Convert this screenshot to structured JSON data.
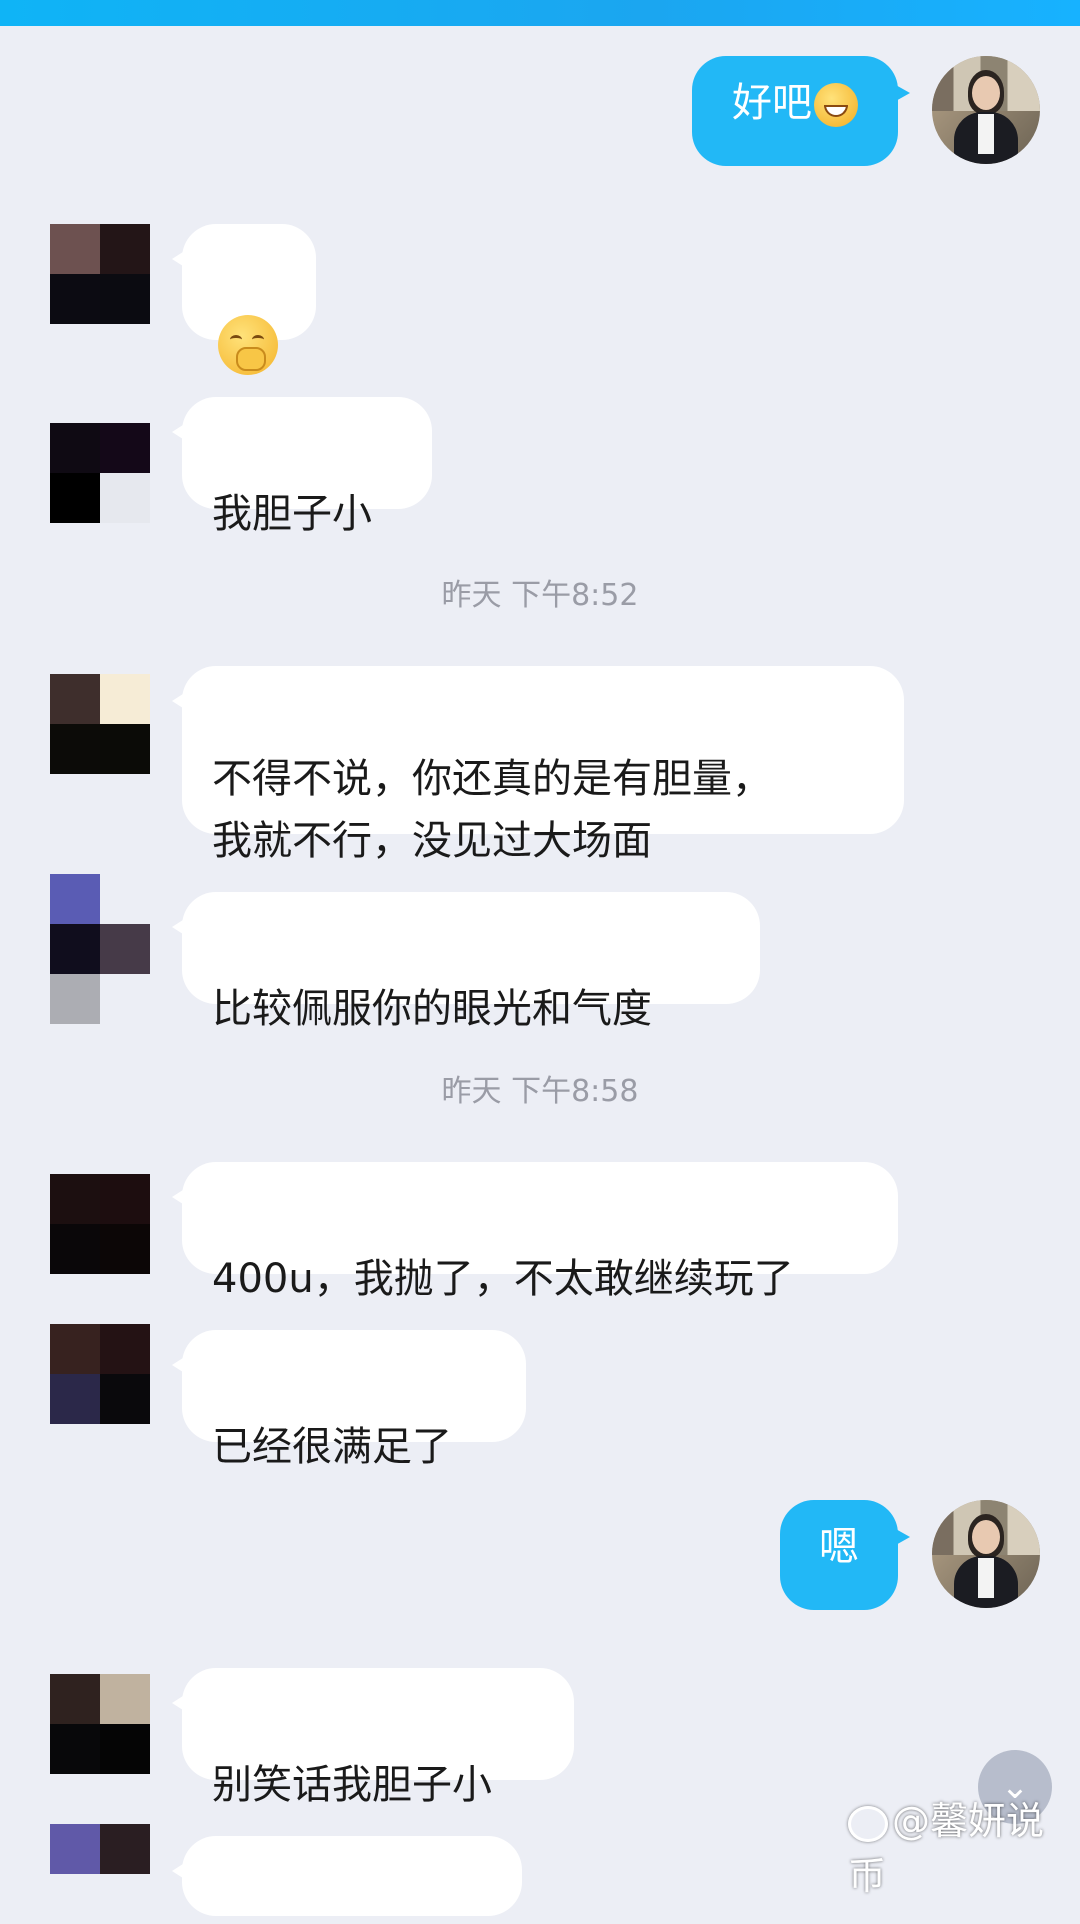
{
  "header": {
    "title": ""
  },
  "messages": [
    {
      "id": "m1",
      "direction": "out",
      "text": "好吧",
      "emoji": "laughing-tears-emoji"
    },
    {
      "id": "m2",
      "direction": "in",
      "text": "",
      "emoji": "smirk-hand-over-mouth-emoji"
    },
    {
      "id": "m3",
      "direction": "in",
      "text": "我胆子小"
    },
    {
      "id": "t1",
      "type": "timestamp",
      "text": "昨天 下午8:52"
    },
    {
      "id": "m4",
      "direction": "in",
      "text": "不得不说，你还真的是有胆量，\n我就不行，没见过大场面"
    },
    {
      "id": "m5",
      "direction": "in",
      "text": "比较佩服你的眼光和气度"
    },
    {
      "id": "t2",
      "type": "timestamp",
      "text": "昨天 下午8:58"
    },
    {
      "id": "m6",
      "direction": "in",
      "text": "400u，我抛了，不太敢继续玩了"
    },
    {
      "id": "m7",
      "direction": "in",
      "text": "已经很满足了"
    },
    {
      "id": "m8",
      "direction": "out",
      "text": "嗯"
    },
    {
      "id": "m9",
      "direction": "in",
      "text": "别笑话我胆子小"
    }
  ],
  "watermark": {
    "text": "@馨妍说币"
  },
  "colors": {
    "outgoing_bubble": "#22b8f6",
    "incoming_bubble": "#ffffff",
    "background": "#eceef5"
  },
  "icons": {
    "scroll_down": "chevron-double-down-icon"
  }
}
